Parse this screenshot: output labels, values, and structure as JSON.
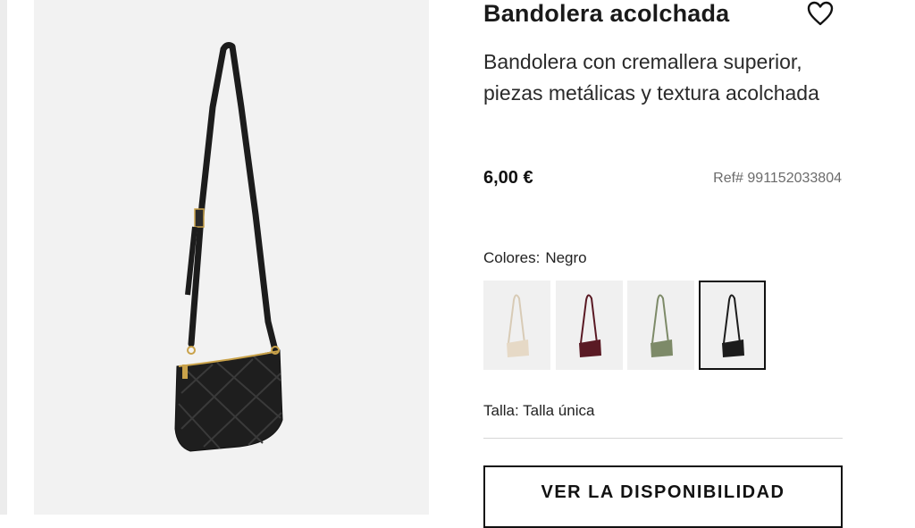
{
  "product": {
    "title": "Bandolera acolchada",
    "description": "Bandolera con cremallera superior, piezas metálicas y textura acolchada",
    "price": "6,00 €",
    "ref": "Ref# 991152033804"
  },
  "colors": {
    "label": "Colores:",
    "selected": "Negro",
    "swatches": [
      {
        "color": "#e6d9c6",
        "name": "beige"
      },
      {
        "color": "#5a1a24",
        "name": "burdeos"
      },
      {
        "color": "#7d8a68",
        "name": "verde"
      },
      {
        "color": "#1c1c1c",
        "name": "negro"
      }
    ]
  },
  "size": {
    "label": "Talla:",
    "value": "Talla única"
  },
  "cta": {
    "label": "VER LA DISPONIBILIDAD"
  },
  "icons": {
    "favorite": "heart-icon"
  }
}
